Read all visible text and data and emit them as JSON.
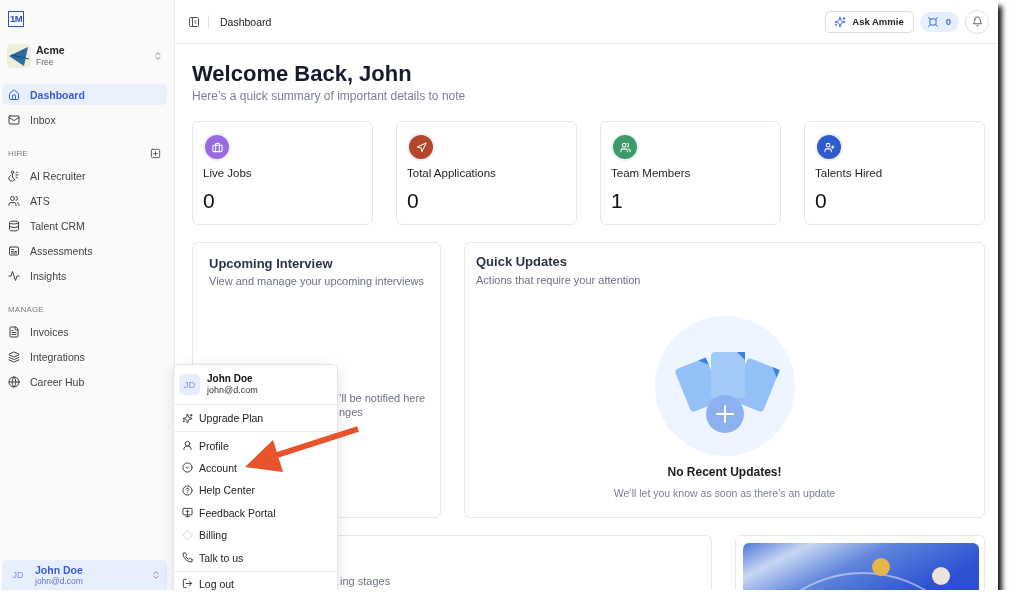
{
  "logo": {
    "text": "1M"
  },
  "workspace": {
    "name": "Acme",
    "plan": "Free"
  },
  "sidebar": {
    "sections": [
      {
        "items": [
          {
            "label": "Dashboard",
            "selected": true
          },
          {
            "label": "Inbox",
            "selected": false
          }
        ]
      },
      {
        "title": "HIRE",
        "items": [
          {
            "label": "AI Recruiter",
            "selected": false
          },
          {
            "label": "ATS",
            "selected": false
          },
          {
            "label": "Talent CRM",
            "selected": false
          },
          {
            "label": "Assessments",
            "selected": false
          },
          {
            "label": "Insights",
            "selected": false
          }
        ]
      },
      {
        "title": "MANAGE",
        "items": [
          {
            "label": "Invoices",
            "selected": false
          },
          {
            "label": "Integrations",
            "selected": false
          },
          {
            "label": "Career Hub",
            "selected": false
          }
        ]
      }
    ]
  },
  "account": {
    "initials": "JD",
    "name": "John Doe",
    "email": "john@d.com"
  },
  "header": {
    "breadcrumb": "Dashboard",
    "ask_button": "Ask Ammie",
    "credits": "0"
  },
  "welcome": {
    "title": "Welcome Back, John",
    "subtitle": "Here’s a quick summary of important details to note"
  },
  "stats": [
    {
      "label": "Live Jobs",
      "value": "0",
      "color": "#9a6ae0"
    },
    {
      "label": "Total Applications",
      "value": "0",
      "color": "#b4462a"
    },
    {
      "label": "Team Members",
      "value": "1",
      "color": "#3e9a68"
    },
    {
      "label": "Talents Hired",
      "value": "0",
      "color": "#2f5ccc"
    }
  ],
  "upcoming_interview": {
    "title": "Upcoming Interview",
    "subtitle": "View and manage your upcoming interviews",
    "visible_lines": [
      "’ll be notified here",
      "nges"
    ]
  },
  "quick_updates": {
    "title": "Quick Updates",
    "subtitle": "Actions that require your attention",
    "empty_title": "No Recent Updates!",
    "empty_text": "We’ll let you know as soon as there’s an update"
  },
  "pipeline_card": {
    "visible_text": "ing stages"
  },
  "user_menu": {
    "open": true,
    "initials": "JD",
    "name": "John Doe",
    "email": "john@d.com",
    "groups": [
      [
        {
          "label": "Upgrade Plan"
        }
      ],
      [
        {
          "label": "Profile"
        },
        {
          "label": "Account"
        },
        {
          "label": "Help Center"
        },
        {
          "label": "Feedback Portal"
        },
        {
          "label": "Billing"
        },
        {
          "label": "Talk to us"
        }
      ],
      [
        {
          "label": "Log out"
        }
      ]
    ]
  }
}
